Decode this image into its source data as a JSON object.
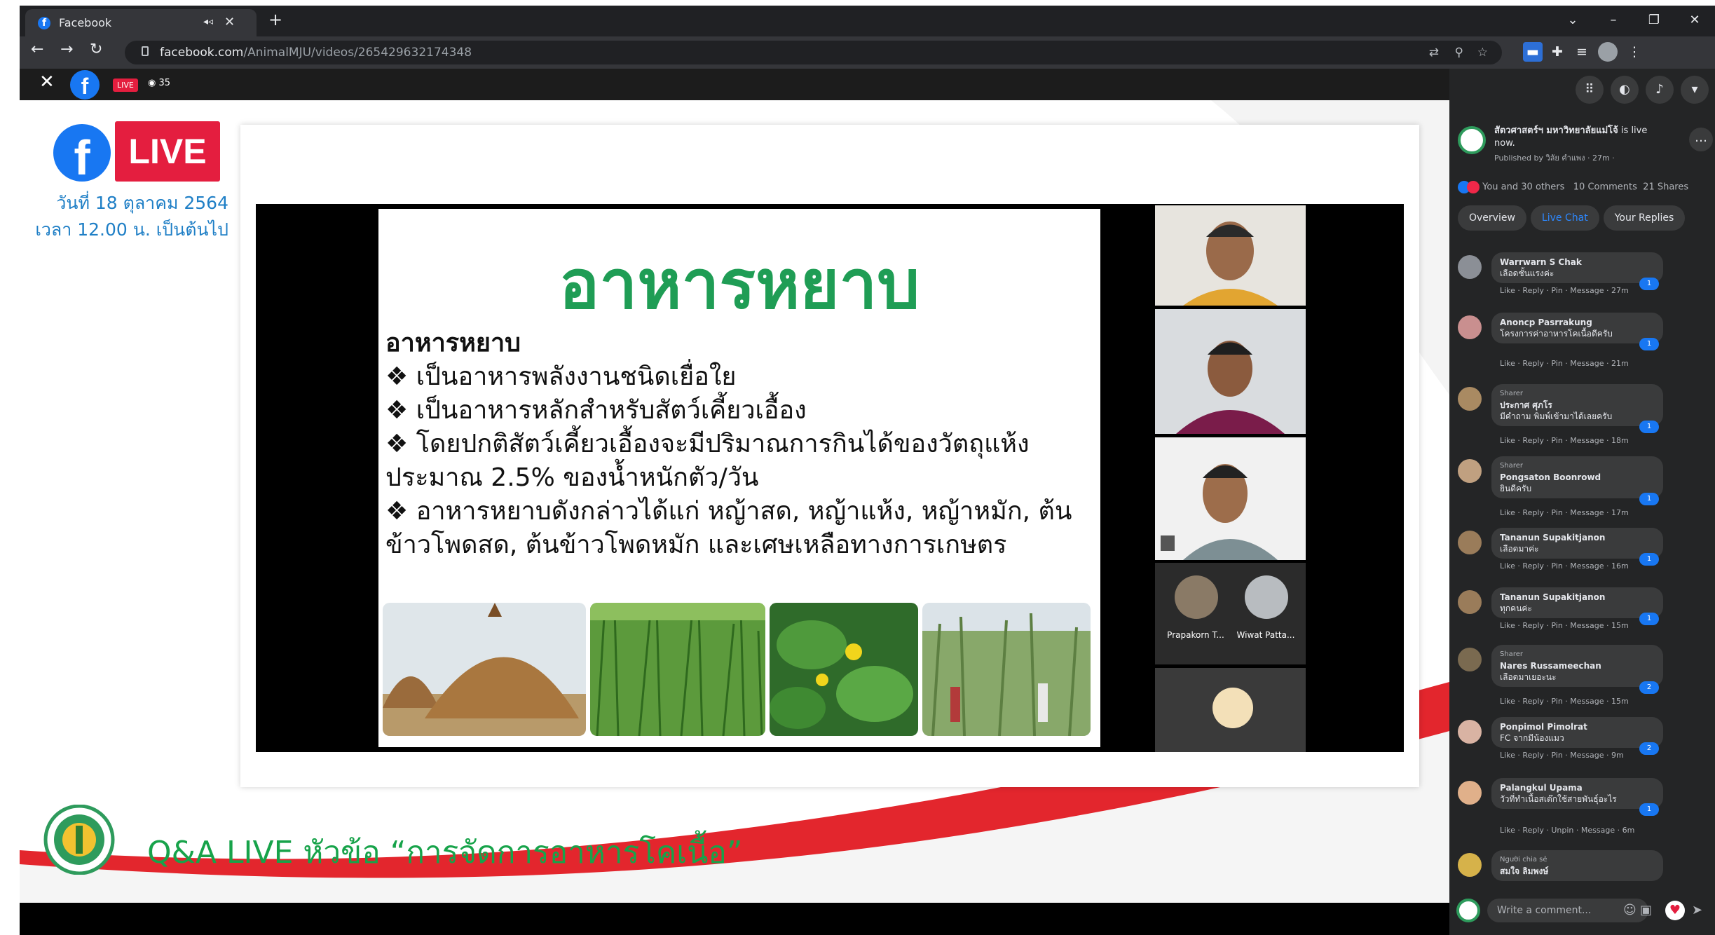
{
  "browser": {
    "tab_title": "Facebook",
    "tab_audio_icon": "speaker-icon",
    "new_tab": "+",
    "url_host": "facebook.com",
    "url_path": "/AnimalMJU/videos/265429632174348",
    "window_controls": [
      "⌄",
      "–",
      "❐",
      "✕"
    ]
  },
  "viewer": {
    "live_badge": "LIVE",
    "viewer_count": "35"
  },
  "broadcast": {
    "logo_f": "f",
    "live_label": "LIVE",
    "date_line": "วันที่ 18 ตุลาคม 2564",
    "time_line": "เวลา 12.00 น. เป็นต้นไป",
    "qa_title": "Q&A LIVE หัวข้อ “การจัดการอาหารโคเนื้อ”"
  },
  "slide": {
    "title": "อาหารหยาบ",
    "subtitle": "อาหารหยาบ",
    "bullets": [
      "❖ เป็นอาหารพลังงานชนิดเยื่อใย",
      "❖ เป็นอาหารหลักสำหรับสัตว์เคี้ยวเอื้อง",
      "❖ โดยปกติสัตว์เคี้ยวเอื้องจะมีปริมาณการกินได้ของวัตถุแห้ง ประมาณ 2.5% ของน้ำหนักตัว/วัน",
      "❖ อาหารหยาบดังกล่าวได้แก่ หญ้าสด, หญ้าแห้ง, หญ้าหมัก, ต้นข้าวโพดสด, ต้นข้าวโพดหมัก และเศษเหลือทางการเกษตร"
    ]
  },
  "participants": [
    {
      "name": "Prapakorn T..."
    },
    {
      "name": "Wiwat Patta..."
    }
  ],
  "sidebar": {
    "page_name": "สัตวศาสตร์ฯ มหาวิทยาลัยแม่โจ้",
    "is_live": "is live now.",
    "published": "Published by วิลัย คำแพง · 27m ·",
    "reactions": "You and 30 others",
    "comments_count": "10 Comments",
    "shares": "21 Shares",
    "tabs": [
      "Overview",
      "Live Chat",
      "Your Replies"
    ],
    "comment_placeholder": "Write a comment..."
  },
  "comments": [
    {
      "sharer": "",
      "author": "Warrwarn S Chak",
      "text": "เลือดชั้นแรงค่ะ",
      "likes": "1",
      "actions": "Like · Reply · Pin · Message · 27m"
    },
    {
      "sharer": "",
      "author": "Anoncp Pasrrakung",
      "text": "โครงการค่าอาหารโคเนื้อดีครับ",
      "likes": "1",
      "actions": "Like · Reply · Pin · Message · 21m"
    },
    {
      "sharer": "Sharer",
      "author": "ประกาศ ศุภโร",
      "text": "มีคำถาม พิมพ์เข้ามาได้เลยครับ",
      "likes": "1",
      "actions": "Like · Reply · Pin · Message · 18m"
    },
    {
      "sharer": "Sharer",
      "author": "Pongsaton Boonrowd",
      "text": "ยินดีครับ",
      "likes": "1",
      "actions": "Like · Reply · Pin · Message · 17m"
    },
    {
      "sharer": "",
      "author": "Tananun Supakitjanon",
      "text": "เลือดมาค่ะ",
      "likes": "1",
      "actions": "Like · Reply · Pin · Message · 16m"
    },
    {
      "sharer": "",
      "author": "Tananun Supakitjanon",
      "text": "ทุกคนค่ะ",
      "likes": "1",
      "actions": "Like · Reply · Pin · Message · 15m"
    },
    {
      "sharer": "Sharer",
      "author": "Nares Russameechan",
      "text": "เลือดมาเยอะนะ",
      "likes": "2",
      "actions": "Like · Reply · Pin · Message · 15m"
    },
    {
      "sharer": "",
      "author": "Ponpimol Pimolrat",
      "text": "FC จากมีน้องแมว",
      "likes": "2",
      "actions": "Like · Reply · Pin · Message · 9m"
    },
    {
      "sharer": "",
      "author": "Palangkul Upama",
      "text": "วัวที่ทำเนื้อสเต๊กใช้สายพันธุ์อะไร",
      "likes": "1",
      "actions": "Like · Reply · Unpin · Message · 6m"
    },
    {
      "sharer": "Người chia sẻ",
      "author": "สมใจ ลิมพงษ์",
      "text": "",
      "likes": "",
      "actions": ""
    }
  ],
  "colors": {
    "facebook_blue": "#1877f2",
    "live_red": "#e41e3f",
    "slide_title_green": "#1f9d55",
    "qa_green": "#17a34a"
  }
}
